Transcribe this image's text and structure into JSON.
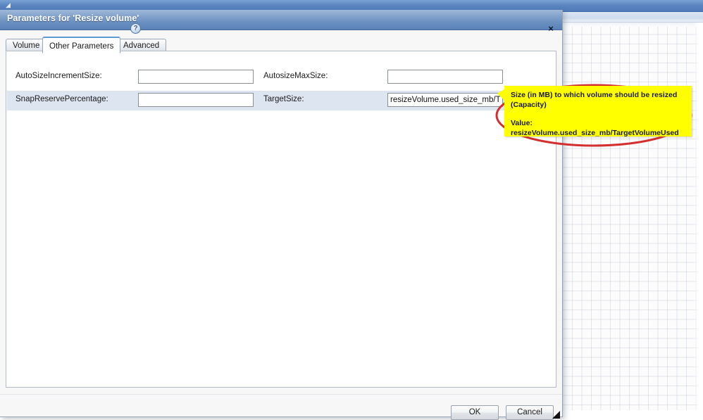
{
  "host": {
    "titlebar_glyph": "icon-app-small",
    "subbar_ghost_text": ""
  },
  "dialog": {
    "title": "Parameters for 'Resize volume'",
    "help_icon": "help-question-icon",
    "close_icon": "×",
    "tabs": [
      {
        "id": "volume",
        "label": "Volume",
        "selected": false
      },
      {
        "id": "other",
        "label": "Other Parameters",
        "selected": true
      },
      {
        "id": "advanced",
        "label": "Advanced",
        "selected": false
      }
    ],
    "fields": [
      {
        "left_label": "AutoSizeIncrementSize:",
        "left_value": "",
        "left_placeholder": "",
        "right_label": "AutosizeMaxSize:",
        "right_value": "",
        "right_placeholder": "",
        "highlighted": false
      },
      {
        "left_label": "SnapReservePercentage:",
        "left_value": "",
        "left_placeholder": "",
        "right_label": "TargetSize:",
        "right_value": "resizeVolume.used_size_mb/TargetVolumeUsed",
        "right_placeholder": "",
        "highlighted": true
      }
    ],
    "buttons": {
      "ok": "OK",
      "cancel": "Cancel"
    },
    "resize_grip": "resize-grip-icon"
  },
  "tooltip": {
    "line1": "Size (in MB) to which volume should be resized",
    "line2": "(Capacity)",
    "line3": "Value:",
    "line4": "resizeVolume.used_size_mb/TargetVolumeUsed",
    "background_color": "#ffff00"
  },
  "annotation": {
    "shape": "ellipse",
    "color": "#d32f2f",
    "stroke_width": 3
  },
  "colors": {
    "dialog_title_bar": "#6b90c1",
    "selected_tab_accent": "#5b9bd5",
    "highlight_row": "#dde5f1",
    "tooltip_yellow": "#ffff00",
    "annotation_red": "#d32f2f"
  }
}
